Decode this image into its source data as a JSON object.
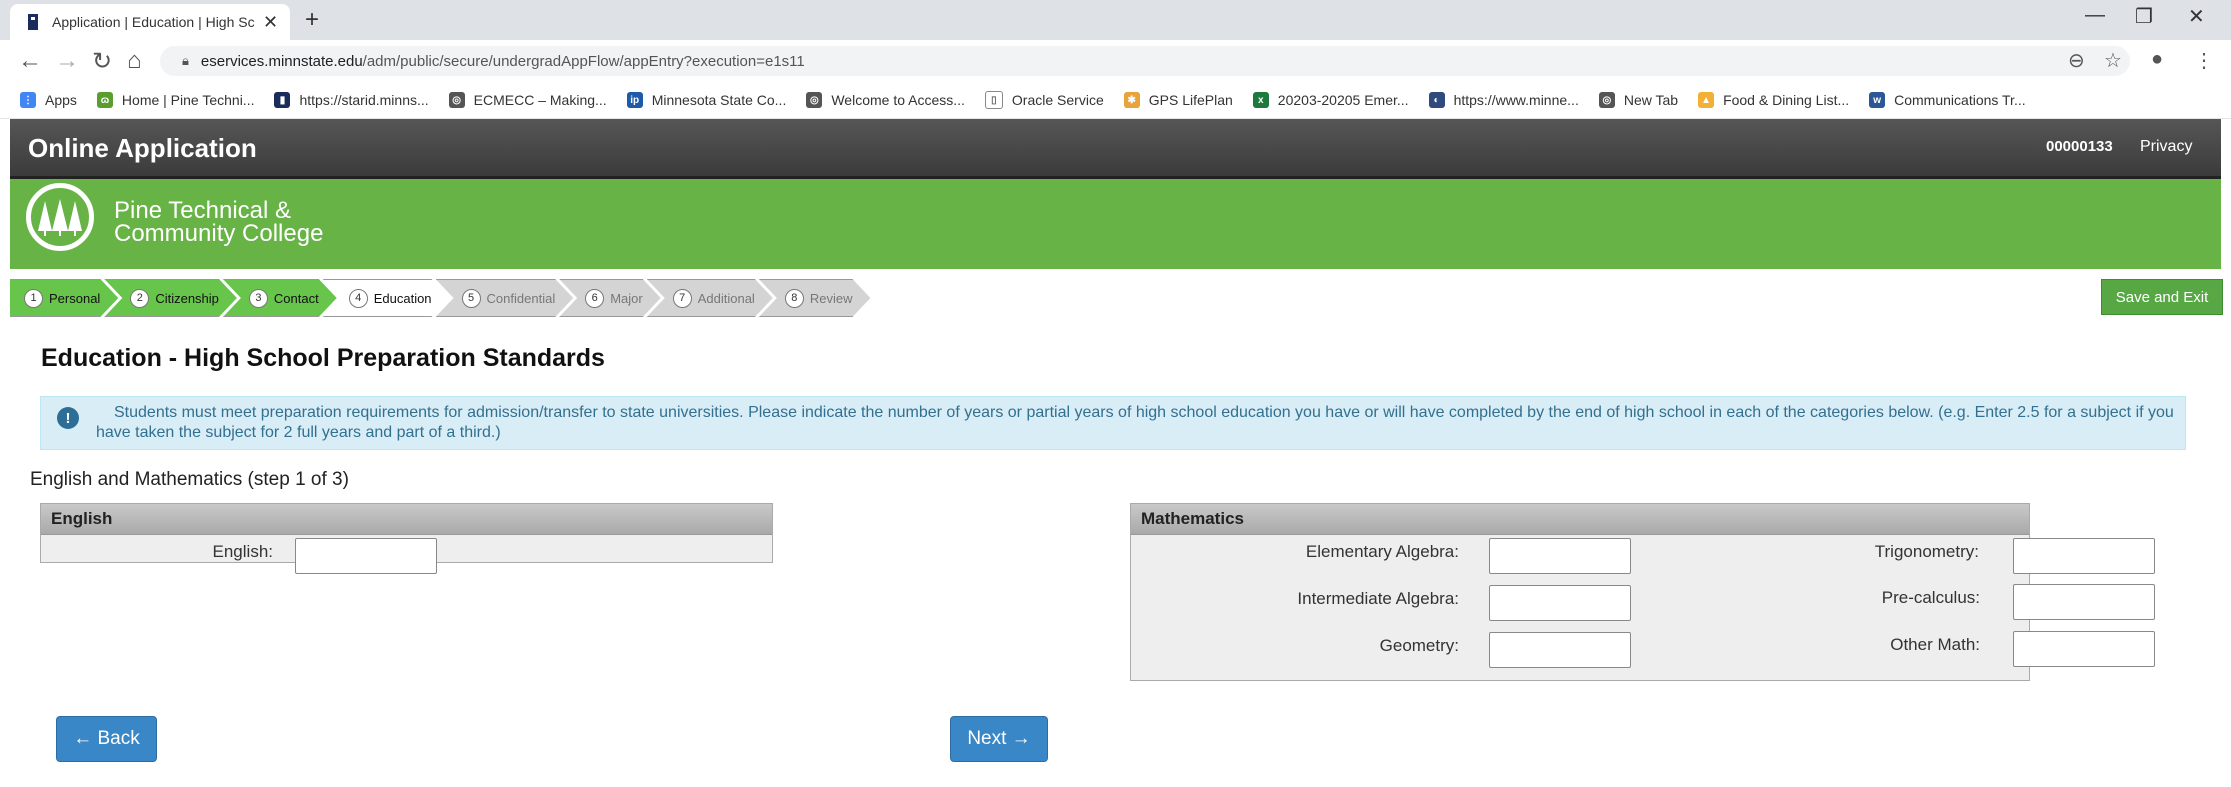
{
  "browser": {
    "tab_title": "Application | Education | High Sc",
    "url_host": "eservices.minnstate.edu",
    "url_path": "/adm/public/secure/undergradAppFlow/appEntry?execution=e1s11",
    "bookmarks": [
      {
        "label": "Apps",
        "color": "#4285f4",
        "glyph": "⋮⋮⋮"
      },
      {
        "label": "Home | Pine Techni...",
        "color": "#5a9e2f",
        "glyph": "ɷ"
      },
      {
        "label": "https://starid.minns...",
        "color": "#1a2c5b",
        "glyph": "▮"
      },
      {
        "label": "ECMECC – Making...",
        "color": "#555555",
        "glyph": "◎"
      },
      {
        "label": "Minnesota State Co...",
        "color": "#1e5aa8",
        "glyph": "ip"
      },
      {
        "label": "Welcome to Access...",
        "color": "#555555",
        "glyph": "◎"
      },
      {
        "label": "Oracle Service",
        "color": "#ffffff",
        "glyph": "▯"
      },
      {
        "label": "GPS LifePlan",
        "color": "#e8a33a",
        "glyph": "✱"
      },
      {
        "label": "20203-20205 Emer...",
        "color": "#1d7a3c",
        "glyph": "x"
      },
      {
        "label": "https://www.minne...",
        "color": "#2f4a7c",
        "glyph": "◐"
      },
      {
        "label": "New Tab",
        "color": "#555555",
        "glyph": "◎"
      },
      {
        "label": "Food & Dining List...",
        "color": "#f2b134",
        "glyph": "▲"
      },
      {
        "label": "Communications Tr...",
        "color": "#2b5797",
        "glyph": "w"
      }
    ]
  },
  "header": {
    "title": "Online Application",
    "app_id": "00000133",
    "privacy": "Privacy"
  },
  "brand": {
    "line1": "Pine Technical &",
    "line2": "Community College"
  },
  "steps": [
    {
      "num": "1",
      "label": "Personal",
      "state": "done"
    },
    {
      "num": "2",
      "label": "Citizenship",
      "state": "done"
    },
    {
      "num": "3",
      "label": "Contact",
      "state": "done"
    },
    {
      "num": "4",
      "label": "Education",
      "state": "current"
    },
    {
      "num": "5",
      "label": "Confidential",
      "state": "todo"
    },
    {
      "num": "6",
      "label": "Major",
      "state": "todo"
    },
    {
      "num": "7",
      "label": "Additional",
      "state": "todo"
    },
    {
      "num": "8",
      "label": "Review",
      "state": "todo"
    }
  ],
  "save_exit": "Save and Exit",
  "page_title": "Education - High School Preparation Standards",
  "alert_text": "Students must meet preparation requirements for admission/transfer to state universities. Please indicate the number of years or partial years of high school education you have or will have completed by the end of high school in each of the categories below. (e.g. Enter 2.5 for a subject if you have taken the subject for 2 full years and part of a third.)",
  "section_heading": "English and Mathematics (step 1 of 3)",
  "english": {
    "title": "English",
    "english_label": "English:",
    "english_value": ""
  },
  "math": {
    "title": "Mathematics",
    "elementary_algebra": "Elementary Algebra:",
    "intermediate_algebra": "Intermediate Algebra:",
    "geometry": "Geometry:",
    "trigonometry": "Trigonometry:",
    "precalculus": "Pre-calculus:",
    "other_math": "Other Math:"
  },
  "back_label": "← Back",
  "next_label": "Next →"
}
